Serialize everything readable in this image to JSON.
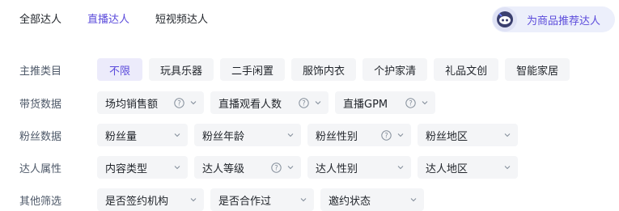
{
  "tabs": [
    {
      "label": "全部达人",
      "active": false
    },
    {
      "label": "直播达人",
      "active": true
    },
    {
      "label": "短视频达人",
      "active": false
    }
  ],
  "recommend_button": {
    "label": "为商品推荐达人"
  },
  "filters": {
    "main_category": {
      "label": "主推类目",
      "options": [
        "不限",
        "玩具乐器",
        "二手闲置",
        "服饰内衣",
        "个护家清",
        "礼品文创",
        "智能家居"
      ],
      "selected": "不限"
    },
    "sales_data": {
      "label": "带货数据",
      "selects": [
        {
          "label": "场均销售额",
          "help": true
        },
        {
          "label": "直播观看人数",
          "help": true
        },
        {
          "label": "直播GPM",
          "help": true
        }
      ]
    },
    "fans_data": {
      "label": "粉丝数据",
      "selects": [
        {
          "label": "粉丝量",
          "help": false
        },
        {
          "label": "粉丝年龄",
          "help": false
        },
        {
          "label": "粉丝性别",
          "help": true
        },
        {
          "label": "粉丝地区",
          "help": false
        }
      ]
    },
    "creator_attributes": {
      "label": "达人属性",
      "selects": [
        {
          "label": "内容类型",
          "help": false
        },
        {
          "label": "达人等级",
          "help": true
        },
        {
          "label": "达人性别",
          "help": false
        },
        {
          "label": "达人地区",
          "help": false
        }
      ]
    },
    "other": {
      "label": "其他筛选",
      "selects": [
        {
          "label": "是否签约机构",
          "help": false
        },
        {
          "label": "是否合作过",
          "help": false
        },
        {
          "label": "邀约状态",
          "help": false
        }
      ]
    }
  },
  "colors": {
    "accent": "#5b4bdb",
    "chip_bg": "#f4f5f7",
    "active_chip_bg": "#ecebfb"
  }
}
